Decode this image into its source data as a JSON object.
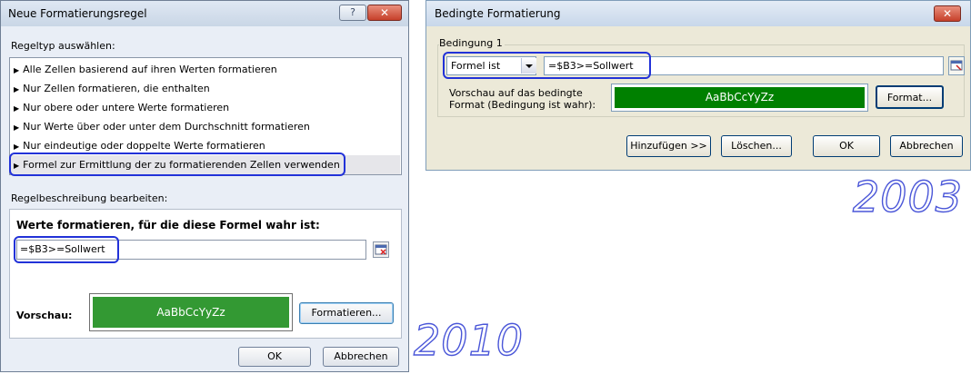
{
  "dialog_2010": {
    "title": "Neue Formatierungsregel",
    "help_button": "?",
    "close_button": "✕",
    "rule_type_label": "Regeltyp auswählen:",
    "rule_types": [
      "Alle Zellen basierend auf ihren Werten formatieren",
      "Nur Zellen formatieren, die enthalten",
      "Nur obere oder untere Werte formatieren",
      "Nur Werte über oder unter dem Durchschnitt formatieren",
      "Nur eindeutige oder doppelte Werte formatieren",
      "Formel zur Ermittlung der zu formatierenden Zellen verwenden"
    ],
    "selected_rule_index": 5,
    "description_label": "Regelbeschreibung bearbeiten:",
    "formula_heading": "Werte formatieren, für die diese Formel wahr ist:",
    "formula_value": "=$B3>=Sollwert",
    "preview_label": "Vorschau:",
    "preview_sample": "AaBbCcYyZz",
    "format_button": "Formatieren...",
    "ok_button": "OK",
    "cancel_button": "Abbrechen",
    "preview_color": "#339933"
  },
  "dialog_2003": {
    "title": "Bedingte Formatierung",
    "close_button": "✕",
    "condition_label": "Bedingung 1",
    "condition_type": "Formel ist",
    "formula_value": "=$B3>=Sollwert",
    "preview_caption_line1": "Vorschau auf das bedingte",
    "preview_caption_line2": "Format (Bedingung ist wahr):",
    "preview_sample": "AaBbCcYyZz",
    "format_button": "Format...",
    "add_button": "Hinzufügen >>",
    "delete_button": "Löschen...",
    "ok_button": "OK",
    "cancel_button": "Abbrechen",
    "preview_color": "#008000"
  },
  "version_labels": {
    "v2003": "2003",
    "v2010": "2010"
  },
  "highlight_color": "#2232d8"
}
